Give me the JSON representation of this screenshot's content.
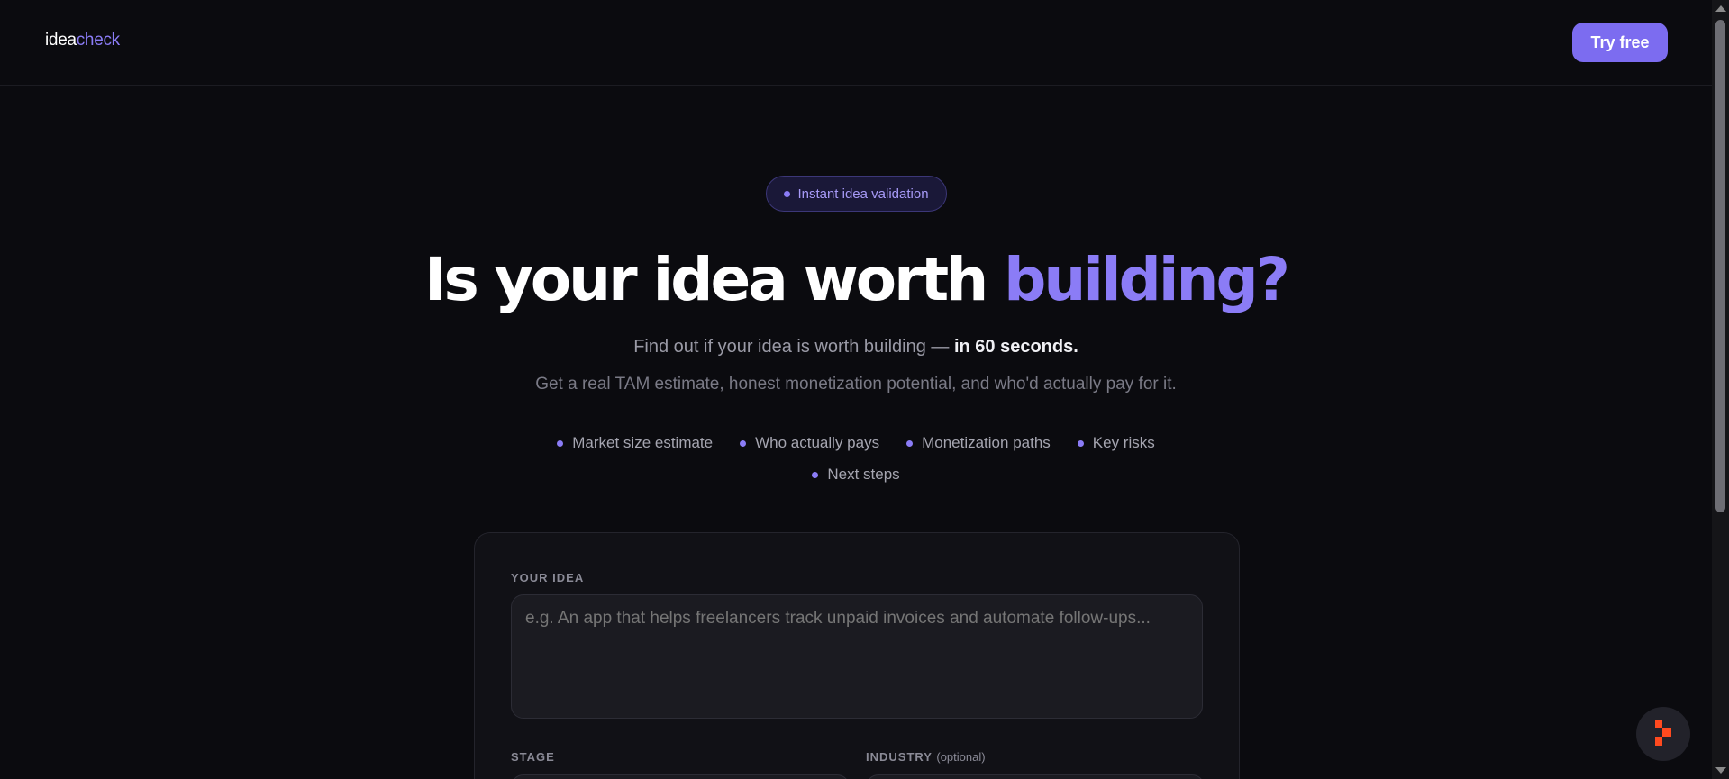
{
  "nav": {
    "logo_part1": "idea",
    "logo_part2": "check",
    "cta_label": "Try free"
  },
  "hero": {
    "badge": "Instant idea validation",
    "headline_main": "Is your idea worth ",
    "headline_accent": "building?",
    "sub1_main": "Find out if your idea is worth building — ",
    "sub1_strong": "in 60 seconds.",
    "sub2": "Get a real TAM estimate, honest monetization potential, and who'd actually pay for it."
  },
  "features": [
    "Market size estimate",
    "Who actually pays",
    "Monetization paths",
    "Key risks",
    "Next steps"
  ],
  "form": {
    "idea_label": "YOUR IDEA",
    "idea_placeholder": "e.g. An app that helps freelancers track unpaid invoices and automate follow-ups...",
    "stage_label": "STAGE",
    "industry_label": "INDUSTRY",
    "industry_optional": "(optional)"
  },
  "colors": {
    "accent": "#8b7cf6",
    "button": "#7c6cf0",
    "background": "#0b0b0f"
  },
  "icons": {
    "fab": "toolbar-logo-icon"
  }
}
